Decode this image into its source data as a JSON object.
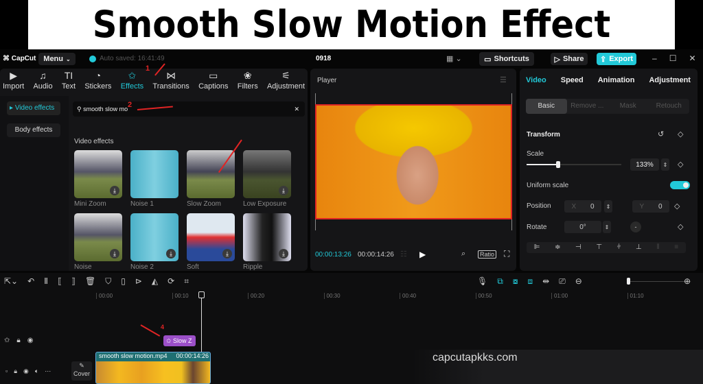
{
  "banner": {
    "title": "Smooth Slow Motion Effect",
    "watermark": "capcutapkks.com"
  },
  "topbar": {
    "logo": "CapCut",
    "menu": "Menu",
    "autosave": "Auto saved: 16:41:49",
    "project": "0918",
    "shortcuts": "Shortcuts",
    "share": "Share",
    "export": "Export",
    "accent": "#22c9d8"
  },
  "toolbar": {
    "items": [
      {
        "label": "Import",
        "icon": "import-icon"
      },
      {
        "label": "Audio",
        "icon": "audio-icon"
      },
      {
        "label": "Text",
        "icon": "text-icon"
      },
      {
        "label": "Stickers",
        "icon": "stickers-icon"
      },
      {
        "label": "Effects",
        "icon": "effects-icon"
      },
      {
        "label": "Transitions",
        "icon": "transitions-icon"
      },
      {
        "label": "Captions",
        "icon": "captions-icon"
      },
      {
        "label": "Filters",
        "icon": "filters-icon"
      },
      {
        "label": "Adjustment",
        "icon": "adjustment-icon"
      }
    ],
    "active": "Effects"
  },
  "sidebar": {
    "items": [
      {
        "label": "Video effects"
      },
      {
        "label": "Body effects"
      }
    ]
  },
  "search": {
    "value": "smooth slow mo"
  },
  "effects": {
    "heading": "Video effects",
    "items": [
      {
        "label": "Mini Zoom"
      },
      {
        "label": "Noise 1"
      },
      {
        "label": "Slow Zoom"
      },
      {
        "label": "Low Exposure"
      },
      {
        "label": "Noise"
      },
      {
        "label": "Noise 2"
      },
      {
        "label": "Soft"
      },
      {
        "label": "Ripple"
      }
    ]
  },
  "annotations": {
    "step1": "1",
    "step2": "2",
    "step4": "4"
  },
  "player": {
    "title": "Player",
    "current_time": "00:00:13:26",
    "total_time": "00:00:14:26",
    "ratio": "Ratio"
  },
  "inspector": {
    "tabs": [
      "Video",
      "Speed",
      "Animation",
      "Adjustment"
    ],
    "subtabs": [
      "Basic",
      "Remove ...",
      "Mask",
      "Retouch"
    ],
    "section": "Transform",
    "scale_label": "Scale",
    "scale_value": "133%",
    "scale_fraction": 0.33,
    "uniform_label": "Uniform scale",
    "uniform_on": true,
    "position_label": "Position",
    "x_label": "X",
    "x_value": "0",
    "y_label": "Y",
    "y_value": "0",
    "rotate_label": "Rotate",
    "rotate_value": "0°"
  },
  "timeline": {
    "ruler": [
      "00:00",
      "00:10",
      "00:20",
      "00:30",
      "00:40",
      "00:50",
      "01:00",
      "01:10"
    ],
    "effect_clip": "Slow Z",
    "video_clip": {
      "name": "smooth slow motion.mp4",
      "duration": "00:00:14:26"
    },
    "cover": "Cover"
  }
}
